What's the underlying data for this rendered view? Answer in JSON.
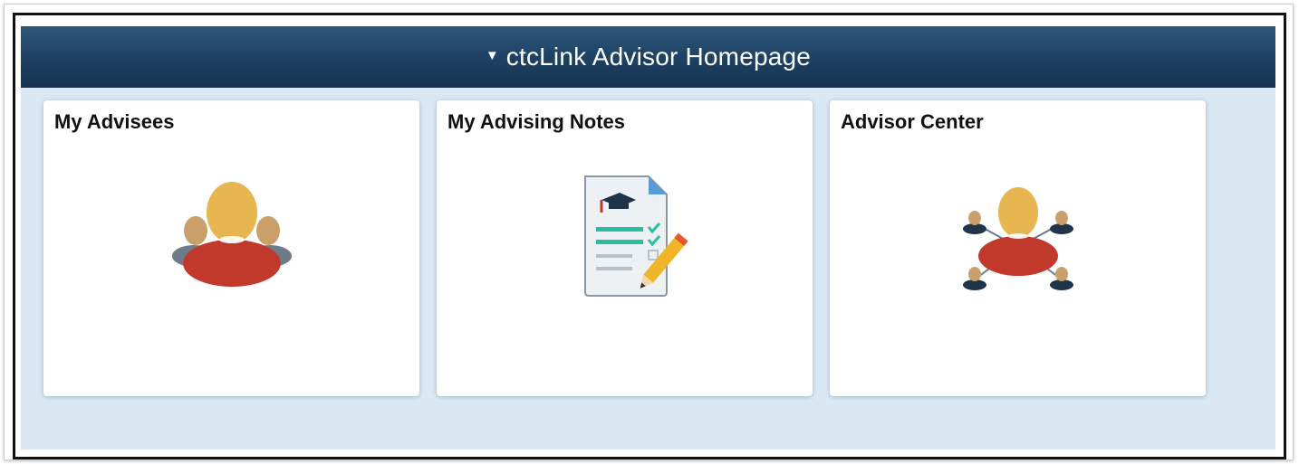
{
  "homepage": {
    "title": "ctcLink Advisor Homepage"
  },
  "tiles": [
    {
      "title": "My Advisees",
      "icon": "advisees-group-icon"
    },
    {
      "title": "My Advising Notes",
      "icon": "advising-notes-icon"
    },
    {
      "title": "Advisor Center",
      "icon": "advisor-network-icon"
    }
  ],
  "colors": {
    "banner": "#1f4466",
    "background": "#dae8f4",
    "person_head": "#e8b650",
    "person_body": "#c0392b",
    "notes_green": "#2bbfa2"
  }
}
